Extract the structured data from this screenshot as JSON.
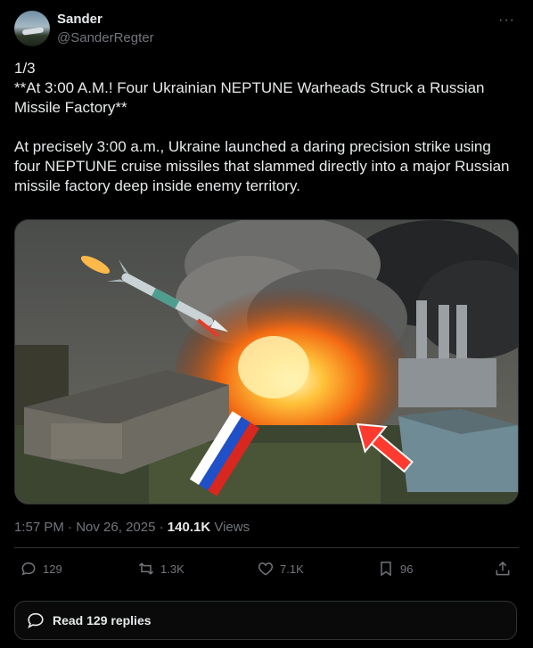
{
  "user": {
    "name": "Sander",
    "handle": "@SanderRegter"
  },
  "tweet": {
    "text": "1/3\n**At 3:00 A.M.! Four Ukrainian NEPTUNE Warheads Struck a Russian Missile Factory**\n\nAt precisely 3:00 a.m., Ukraine launched a daring precision strike using four NEPTUNE cruise missiles that slammed directly into a major Russian missile factory deep inside enemy territory.",
    "time": "1:57 PM",
    "date": "Nov 26, 2025",
    "views_count": "140.1K",
    "views_label": "Views",
    "separator": "·"
  },
  "actions": {
    "replies": "129",
    "reposts": "1.3K",
    "likes": "7.1K",
    "bookmarks": "96"
  },
  "replies_button": {
    "label": "Read 129 replies"
  },
  "icons": {
    "more": "more-dots-icon",
    "reply": "speech-bubble-icon",
    "repost": "repost-arrows-icon",
    "like": "heart-icon",
    "bookmark": "bookmark-icon",
    "share": "share-upload-icon",
    "replies": "replies-bubble-icon"
  },
  "colors": {
    "background": "#000000",
    "text": "#e7e9ea",
    "muted": "#71767b",
    "border": "#2f3336"
  }
}
